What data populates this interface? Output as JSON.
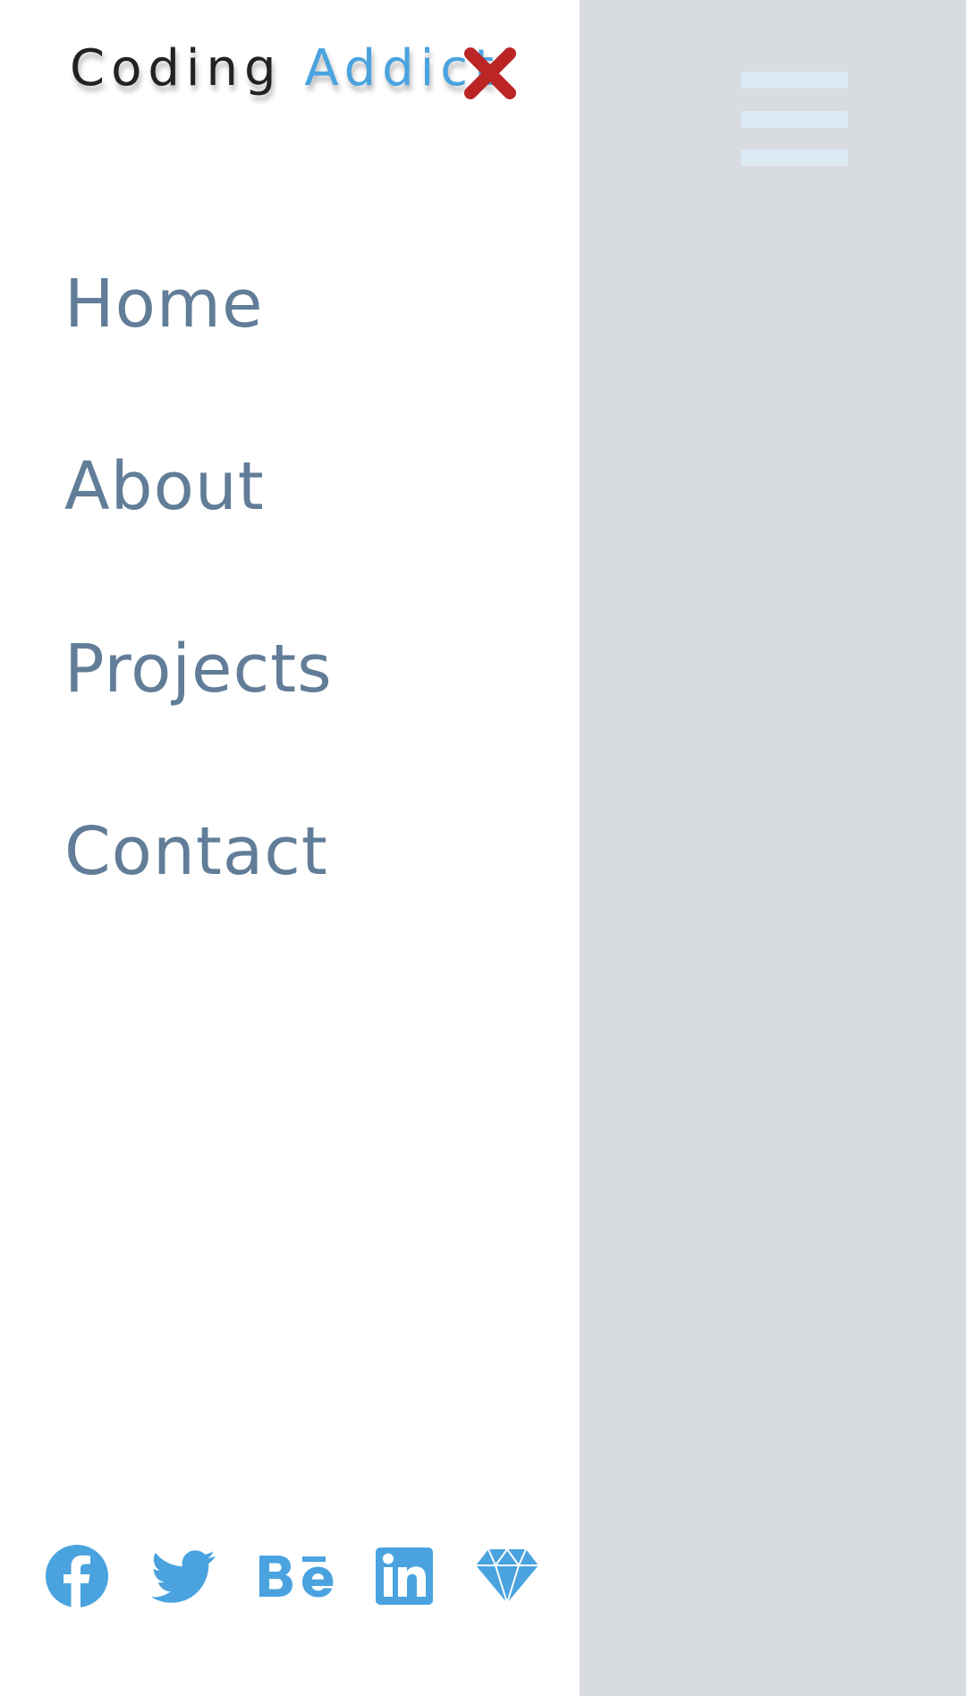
{
  "menu_button": {
    "icon": "hamburger-menu-icon"
  },
  "sidebar": {
    "logo": {
      "part1": "Coding ",
      "part2": "Addict"
    },
    "close_icon": "close-icon",
    "links": [
      {
        "label": "Home"
      },
      {
        "label": "About"
      },
      {
        "label": "Projects"
      },
      {
        "label": "Contact"
      }
    ],
    "social": [
      {
        "icon": "facebook-icon"
      },
      {
        "icon": "twitter-icon"
      },
      {
        "icon": "behance-icon"
      },
      {
        "icon": "linkedin-icon"
      },
      {
        "icon": "sketch-icon"
      }
    ]
  },
  "colors": {
    "primary": "#4aa3df",
    "close": "#bb2525",
    "nav_text": "#617d98",
    "overlay": "#d8dbdf",
    "hamburger": "#dde9f3"
  }
}
